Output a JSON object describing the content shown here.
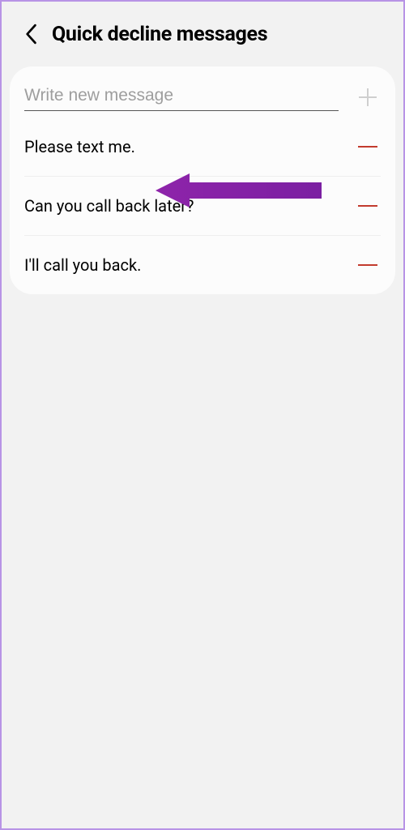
{
  "header": {
    "title": "Quick decline messages"
  },
  "input": {
    "placeholder": "Write new message",
    "value": ""
  },
  "messages": [
    {
      "text": "Please text me."
    },
    {
      "text": "Can you call back later?"
    },
    {
      "text": "I'll call you back."
    }
  ],
  "colors": {
    "accent": "#9c27b0",
    "remove": "#c23b2e"
  }
}
